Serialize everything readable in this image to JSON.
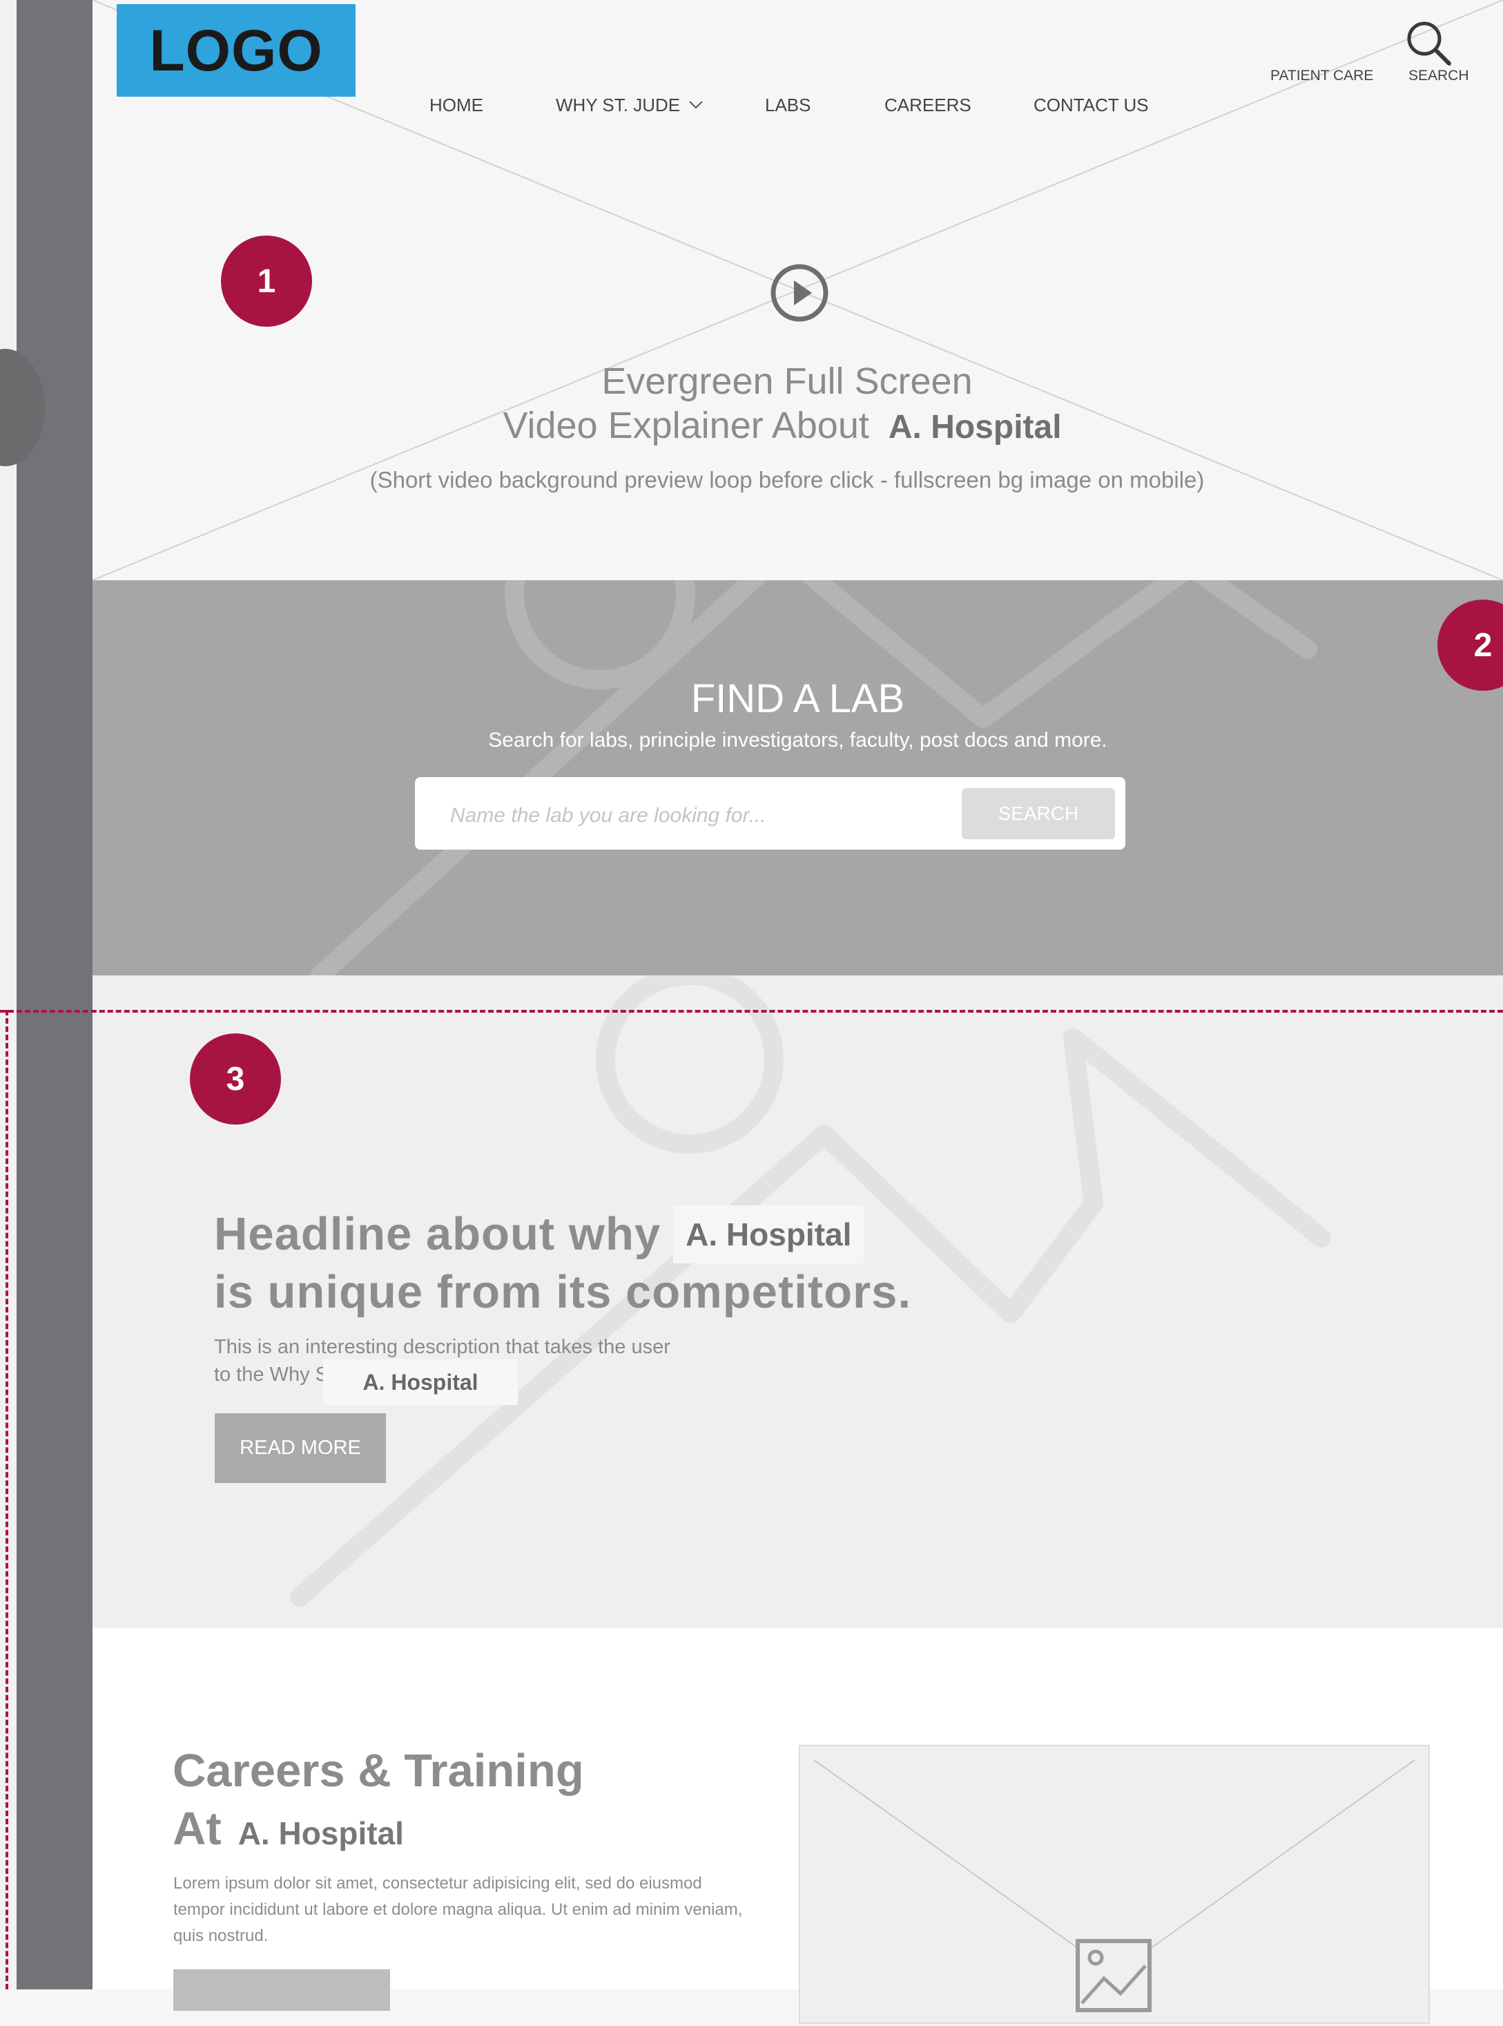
{
  "brand": {
    "logo_text": "LOGO",
    "accent": "#a81442",
    "logo_bg": "#2fa3dc"
  },
  "nav": {
    "items": [
      "HOME",
      "WHY ST. JUDE",
      "LABS",
      "CAREERS",
      "CONTACT US"
    ],
    "utility": {
      "patient_care": "PATIENT CARE",
      "search": "SEARCH"
    }
  },
  "annotations": [
    "1",
    "2",
    "3"
  ],
  "hero": {
    "title_line1": "Evergreen Full Screen",
    "title_line2": "Video Explainer About",
    "hospital": "A. Hospital",
    "subtitle": "(Short video background preview loop before click - fullscreen bg image on mobile)"
  },
  "find_lab": {
    "title": "FIND A LAB",
    "subtitle": "Search for labs, principle investigators, faculty, post docs and more.",
    "placeholder": "Name the lab you are looking for...",
    "button": "SEARCH"
  },
  "why": {
    "headline_line1": "Headline about why",
    "hospital": "A. Hospital",
    "headline_line2": "is unique from its competitors.",
    "desc_line1": "This is an interesting description that takes the user",
    "desc_line2": "to the Why S",
    "desc_hospital": "A. Hospital",
    "button": "READ MORE"
  },
  "careers": {
    "title": "Careers & Training",
    "at": "At",
    "hospital": "A. Hospital",
    "body": "Lorem ipsum dolor sit amet, consectetur adipisicing elit, sed do eiusmod tempor incididunt ut labore et dolore magna aliqua. Ut enim ad minim veniam, quis nostrud."
  }
}
